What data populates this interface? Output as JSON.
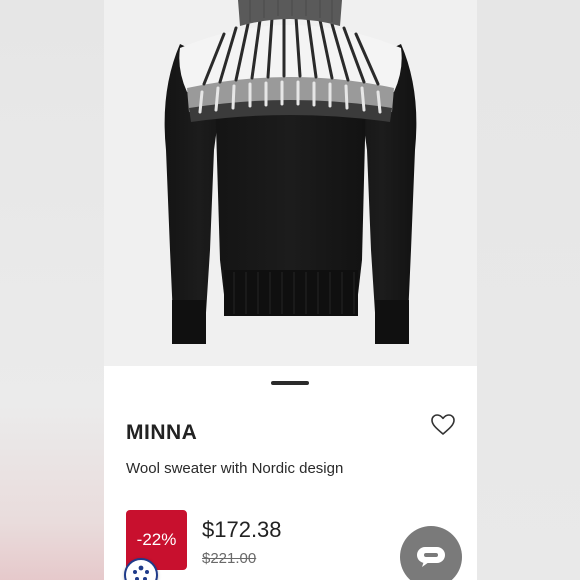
{
  "colors": {
    "sale_badge": "#c8102e",
    "chat_button": "#7a7a7a",
    "text": "#222222",
    "old_price": "#6a6a6a"
  },
  "product": {
    "brand": "MINNA",
    "description": "Wool sweater with Nordic design",
    "discount": "-22%",
    "price": "$172.38",
    "original_price": "$221.00"
  },
  "icons": {
    "favorite": "heart-icon",
    "chat": "chat-icon",
    "accessibility": "accessibility-icon"
  }
}
